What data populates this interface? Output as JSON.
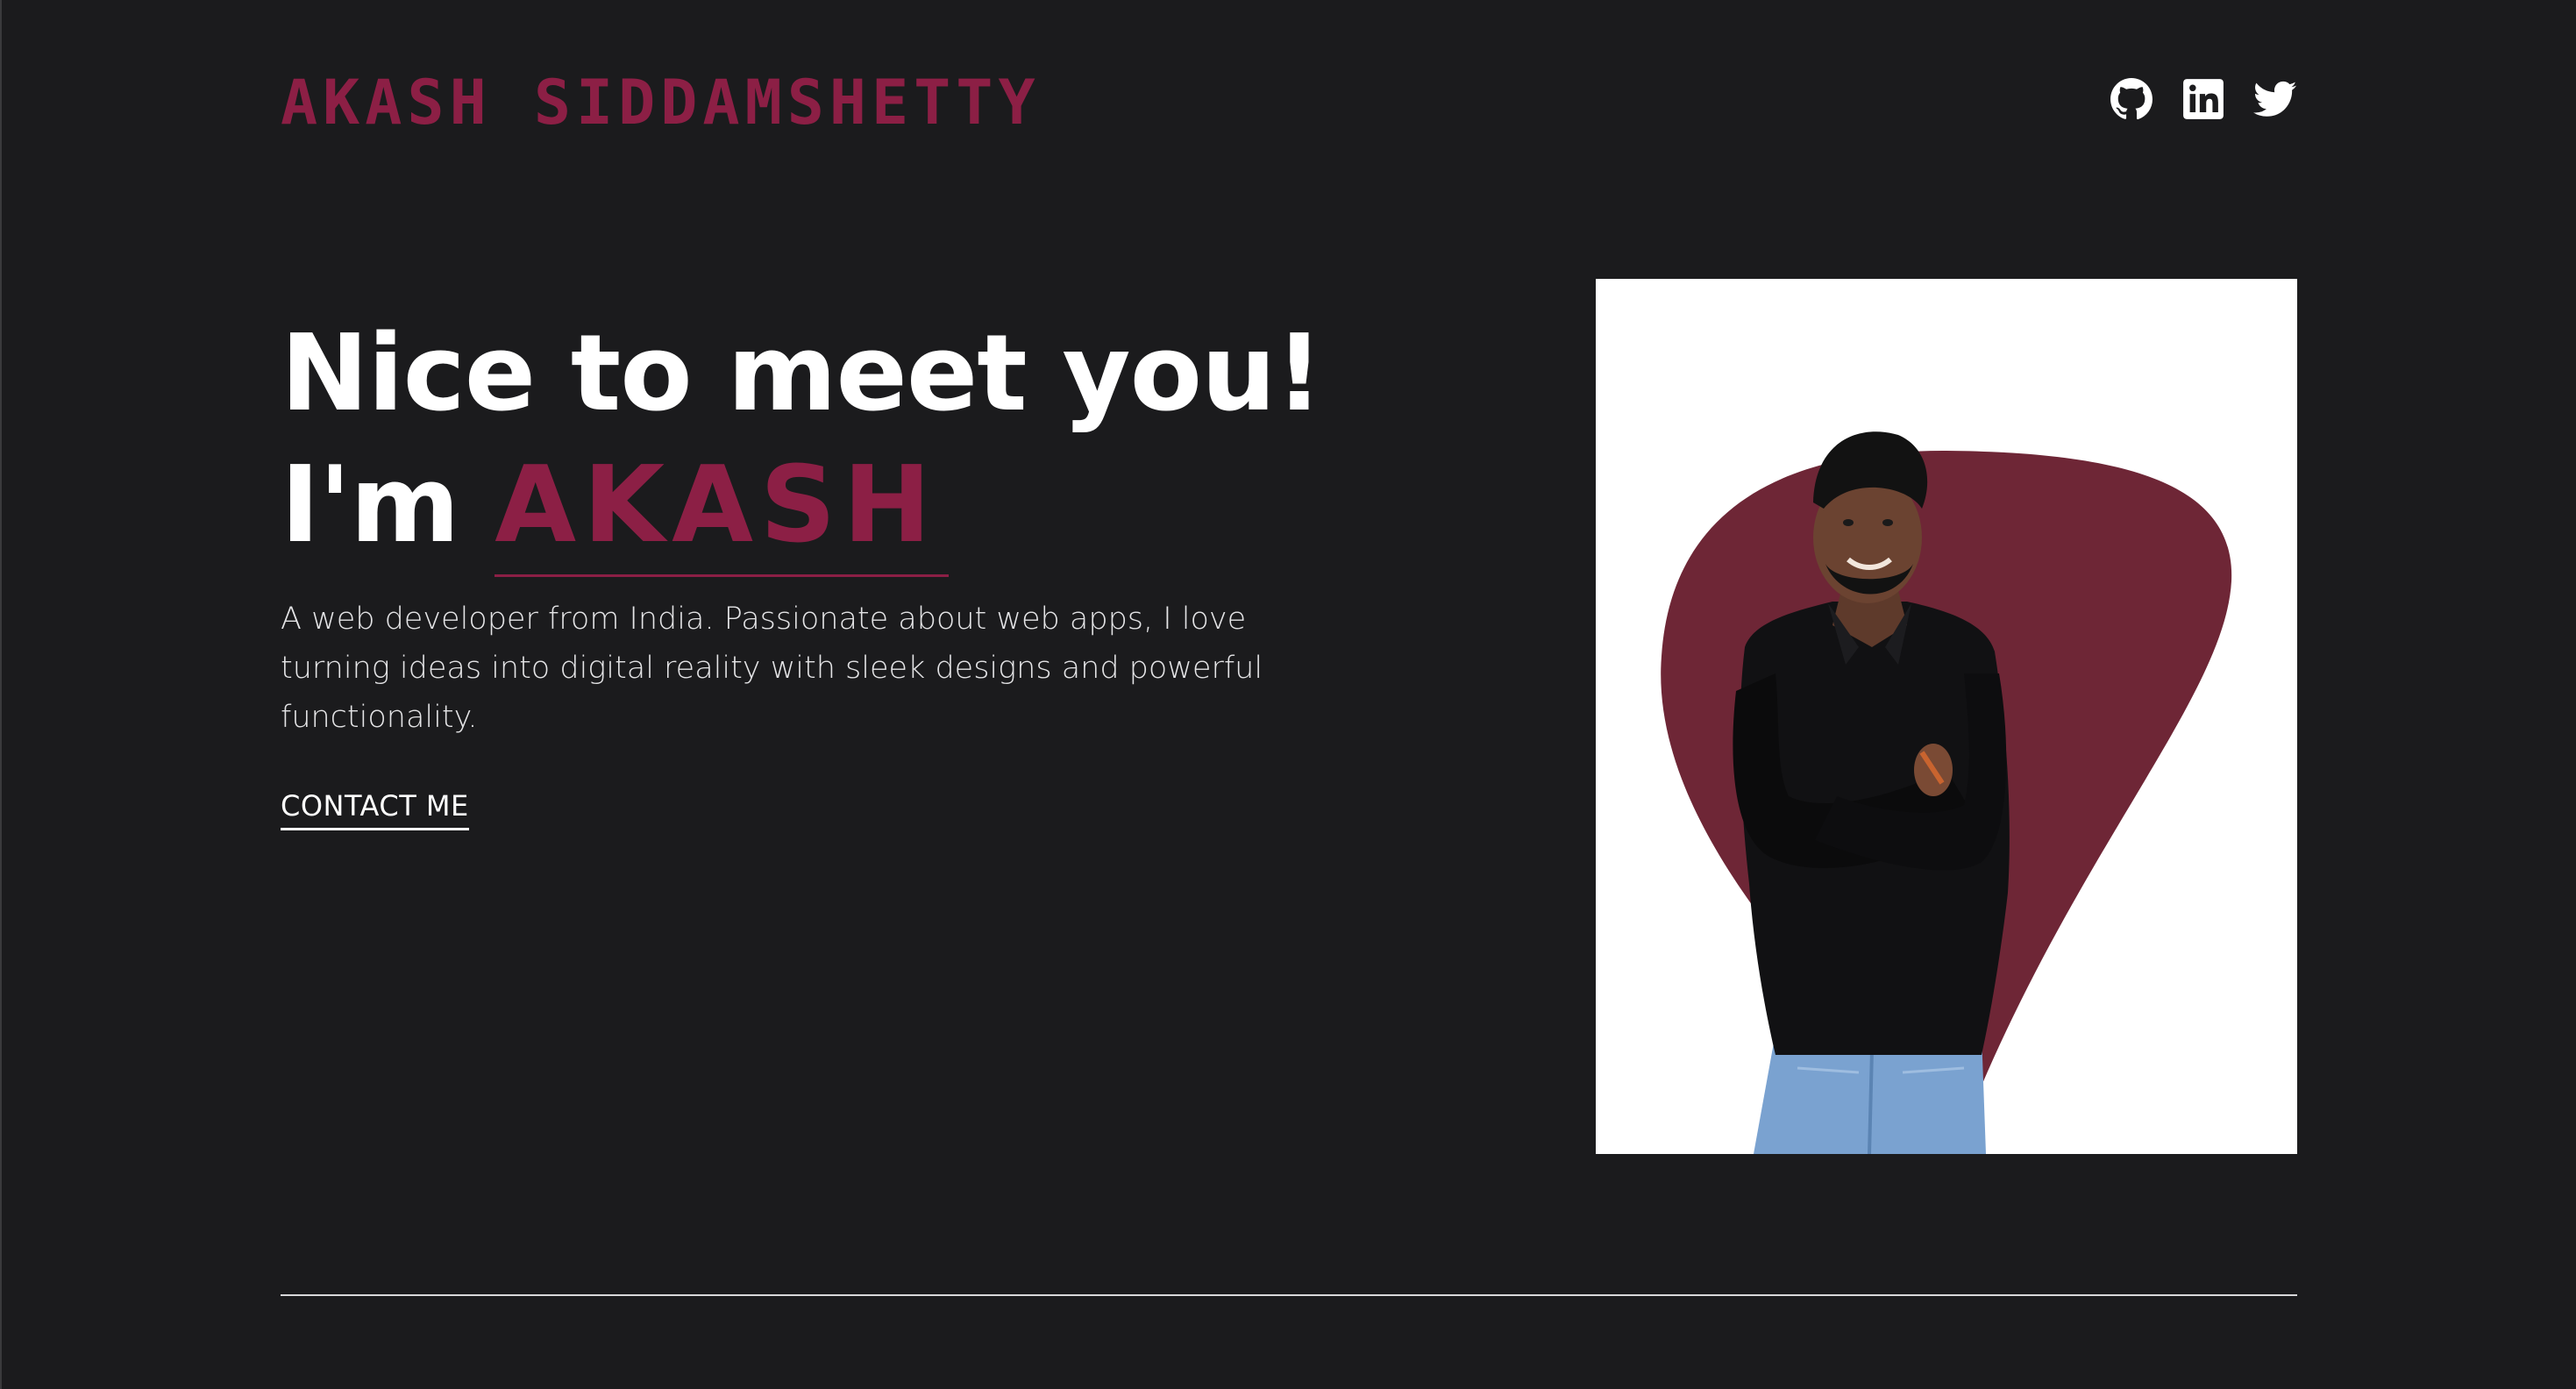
{
  "header": {
    "logo_text": "AKASH SIDDAMSHETTY",
    "social_links": [
      {
        "icon": "github-icon",
        "label": "GitHub"
      },
      {
        "icon": "linkedin-icon",
        "label": "LinkedIn"
      },
      {
        "icon": "twitter-icon",
        "label": "Twitter"
      }
    ]
  },
  "hero": {
    "greeting": "Nice to meet you!",
    "intro_prefix": "I'm ",
    "name": "AKASH",
    "description": "A web developer from India. Passionate about web apps, I love turning ideas into digital reality with sleek designs and powerful functionality.",
    "contact_label": "CONTACT ME"
  },
  "portrait": {
    "subject": "person-portrait",
    "background_shape": "guitar-pick-blob"
  },
  "colors": {
    "page_background": "#1b1b1d",
    "accent": "#8c1f45",
    "blob": "#6e2636",
    "text": "#ffffff",
    "divider": "#d8d8da"
  }
}
